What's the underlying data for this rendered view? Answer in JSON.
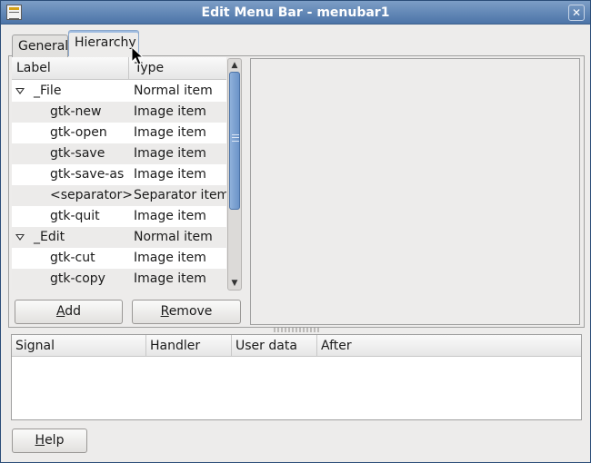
{
  "window": {
    "title": "Edit Menu Bar - menubar1",
    "close_glyph": "✕",
    "icon": "menu-editor-icon"
  },
  "tabs": [
    {
      "label": "General",
      "active": false
    },
    {
      "label": "Hierarchy",
      "active": true
    }
  ],
  "tree": {
    "columns": {
      "label": "Label",
      "type": "Type"
    },
    "rows": [
      {
        "label": "_File",
        "type": "Normal item",
        "level": 0,
        "expanded": true
      },
      {
        "label": "gtk-new",
        "type": "Image item",
        "level": 1
      },
      {
        "label": "gtk-open",
        "type": "Image item",
        "level": 1
      },
      {
        "label": "gtk-save",
        "type": "Image item",
        "level": 1
      },
      {
        "label": "gtk-save-as",
        "type": "Image item",
        "level": 1
      },
      {
        "label": "<separator>",
        "type": "Separator item",
        "level": 1
      },
      {
        "label": "gtk-quit",
        "type": "Image item",
        "level": 1
      },
      {
        "label": "_Edit",
        "type": "Normal item",
        "level": 0,
        "expanded": true
      },
      {
        "label": "gtk-cut",
        "type": "Image item",
        "level": 1
      },
      {
        "label": "gtk-copy",
        "type": "Image item",
        "level": 1
      }
    ],
    "scroll": {
      "up_glyph": "▲",
      "down_glyph": "▼"
    }
  },
  "buttons": {
    "add_mnemonic": "A",
    "add_rest": "dd",
    "remove_mnemonic": "R",
    "remove_rest": "emove",
    "help_mnemonic": "H",
    "help_rest": "elp"
  },
  "signals": {
    "columns": {
      "signal": "Signal",
      "handler": "Handler",
      "user_data": "User data",
      "after": "After"
    },
    "rows": []
  },
  "colors": {
    "title_bar": "#4c74a8",
    "selection_accent": "#6b93c8"
  }
}
